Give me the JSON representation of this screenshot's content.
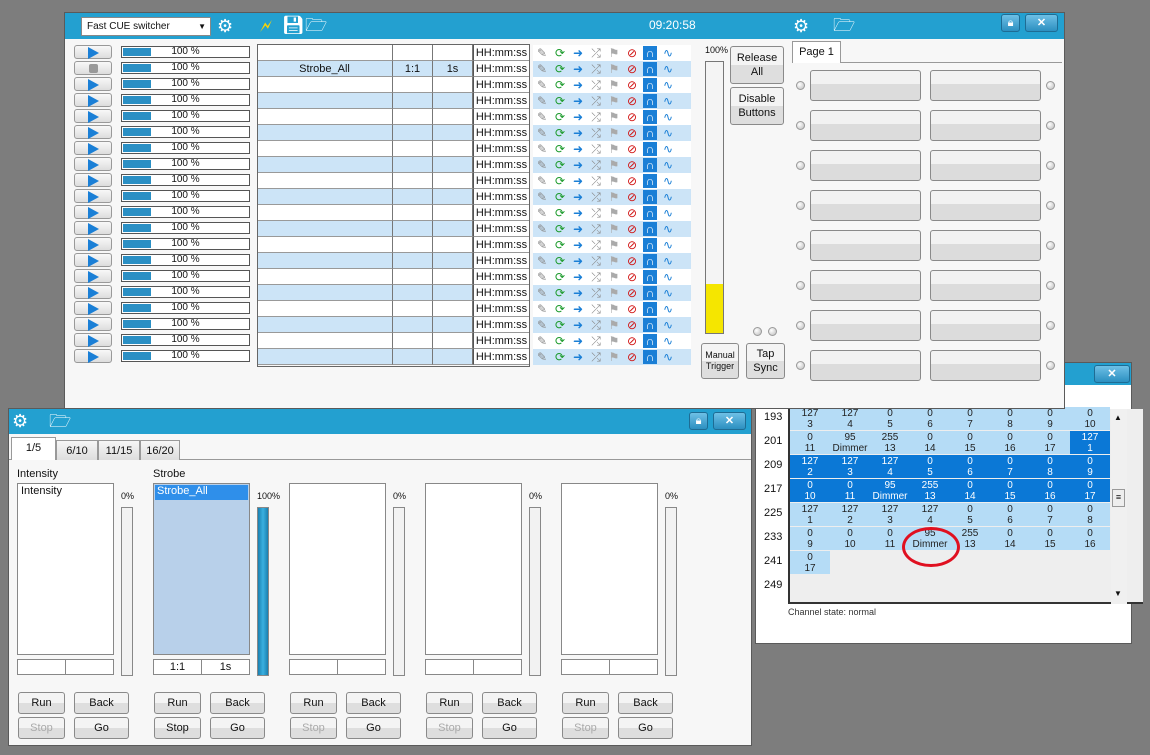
{
  "cue_window": {
    "mode_select": "Fast CUE switcher",
    "clock": "09:20:58",
    "rows": [
      {
        "state": "play",
        "intensity": "100 %",
        "name": "",
        "fade": "",
        "time": "",
        "duration": "HH:mm:ss"
      },
      {
        "state": "stop",
        "intensity": "100 %",
        "name": "Strobe_All",
        "fade": "1:1",
        "time": "1s",
        "duration": "HH:mm:ss"
      },
      {
        "state": "play",
        "intensity": "100 %",
        "name": "",
        "fade": "",
        "time": "",
        "duration": "HH:mm:ss"
      },
      {
        "state": "play",
        "intensity": "100 %",
        "name": "",
        "fade": "",
        "time": "",
        "duration": "HH:mm:ss"
      },
      {
        "state": "play",
        "intensity": "100 %",
        "name": "",
        "fade": "",
        "time": "",
        "duration": "HH:mm:ss"
      },
      {
        "state": "play",
        "intensity": "100 %",
        "name": "",
        "fade": "",
        "time": "",
        "duration": "HH:mm:ss"
      },
      {
        "state": "play",
        "intensity": "100 %",
        "name": "",
        "fade": "",
        "time": "",
        "duration": "HH:mm:ss"
      },
      {
        "state": "play",
        "intensity": "100 %",
        "name": "",
        "fade": "",
        "time": "",
        "duration": "HH:mm:ss"
      },
      {
        "state": "play",
        "intensity": "100 %",
        "name": "",
        "fade": "",
        "time": "",
        "duration": "HH:mm:ss"
      },
      {
        "state": "play",
        "intensity": "100 %",
        "name": "",
        "fade": "",
        "time": "",
        "duration": "HH:mm:ss"
      },
      {
        "state": "play",
        "intensity": "100 %",
        "name": "",
        "fade": "",
        "time": "",
        "duration": "HH:mm:ss"
      },
      {
        "state": "play",
        "intensity": "100 %",
        "name": "",
        "fade": "",
        "time": "",
        "duration": "HH:mm:ss"
      },
      {
        "state": "play",
        "intensity": "100 %",
        "name": "",
        "fade": "",
        "time": "",
        "duration": "HH:mm:ss"
      },
      {
        "state": "play",
        "intensity": "100 %",
        "name": "",
        "fade": "",
        "time": "",
        "duration": "HH:mm:ss"
      },
      {
        "state": "play",
        "intensity": "100 %",
        "name": "",
        "fade": "",
        "time": "",
        "duration": "HH:mm:ss"
      },
      {
        "state": "play",
        "intensity": "100 %",
        "name": "",
        "fade": "",
        "time": "",
        "duration": "HH:mm:ss"
      },
      {
        "state": "play",
        "intensity": "100 %",
        "name": "",
        "fade": "",
        "time": "",
        "duration": "HH:mm:ss"
      },
      {
        "state": "play",
        "intensity": "100 %",
        "name": "",
        "fade": "",
        "time": "",
        "duration": "HH:mm:ss"
      },
      {
        "state": "play",
        "intensity": "100 %",
        "name": "",
        "fade": "",
        "time": "",
        "duration": "HH:mm:ss"
      },
      {
        "state": "play",
        "intensity": "100 %",
        "name": "",
        "fade": "",
        "time": "",
        "duration": "HH:mm:ss"
      }
    ],
    "master_label": "100%",
    "master_level": 0.18,
    "release_all": "Release All",
    "disable_buttons": "Disable Buttons",
    "manual_trigger": "Manual Trigger",
    "tap_sync": "Tap Sync",
    "page_tab": "Page 1",
    "colors": {
      "titlebar": "#23a0d0",
      "row_alt": "#cce4f7",
      "fader": "#f5e600"
    }
  },
  "playback_window": {
    "tabs": [
      "1/5",
      "6/10",
      "11/15",
      "16/20"
    ],
    "panels": [
      {
        "title": "Intensity",
        "item": "Intensity",
        "level": "0%",
        "fill": 0,
        "fade": "",
        "time": "",
        "run": "Run",
        "back": "Back",
        "stop": "Stop",
        "go": "Go",
        "stop_enabled": false
      },
      {
        "title": "Strobe",
        "item": "Strobe_All",
        "level": "100%",
        "fill": 1,
        "fade": "1:1",
        "time": "1s",
        "run": "Run",
        "back": "Back",
        "stop": "Stop",
        "go": "Go",
        "stop_enabled": true
      },
      {
        "title": "",
        "item": "",
        "level": "0%",
        "fill": 0,
        "fade": "",
        "time": "",
        "run": "Run",
        "back": "Back",
        "stop": "Stop",
        "go": "Go",
        "stop_enabled": false
      },
      {
        "title": "",
        "item": "",
        "level": "0%",
        "fill": 0,
        "fade": "",
        "time": "",
        "run": "Run",
        "back": "Back",
        "stop": "Stop",
        "go": "Go",
        "stop_enabled": false
      },
      {
        "title": "",
        "item": "",
        "level": "0%",
        "fill": 0,
        "fade": "",
        "time": "",
        "run": "Run",
        "back": "Back",
        "stop": "Stop",
        "go": "Go",
        "stop_enabled": false
      }
    ]
  },
  "channel_window": {
    "status": "Channel state: normal",
    "rows": [
      {
        "label": "193",
        "cells": [
          [
            "127",
            "3",
            "l"
          ],
          [
            "127",
            "4",
            "l"
          ],
          [
            "0",
            "5",
            "l"
          ],
          [
            "0",
            "6",
            "l"
          ],
          [
            "0",
            "7",
            "l"
          ],
          [
            "0",
            "8",
            "l"
          ],
          [
            "0",
            "9",
            "l"
          ],
          [
            "0",
            "10",
            "l"
          ]
        ]
      },
      {
        "label": "201",
        "cells": [
          [
            "0",
            "11",
            "l"
          ],
          [
            "95",
            "Dimmer",
            "l"
          ],
          [
            "255",
            "13",
            "l"
          ],
          [
            "0",
            "14",
            "l"
          ],
          [
            "0",
            "15",
            "l"
          ],
          [
            "0",
            "16",
            "l"
          ],
          [
            "0",
            "17",
            "l"
          ],
          [
            "127",
            "1",
            "d"
          ]
        ]
      },
      {
        "label": "209",
        "cells": [
          [
            "127",
            "2",
            "d"
          ],
          [
            "127",
            "3",
            "d"
          ],
          [
            "127",
            "4",
            "d"
          ],
          [
            "0",
            "5",
            "d"
          ],
          [
            "0",
            "6",
            "d"
          ],
          [
            "0",
            "7",
            "d"
          ],
          [
            "0",
            "8",
            "d"
          ],
          [
            "0",
            "9",
            "d"
          ]
        ]
      },
      {
        "label": "217",
        "cells": [
          [
            "0",
            "10",
            "d"
          ],
          [
            "0",
            "11",
            "d"
          ],
          [
            "95",
            "Dimmer",
            "d"
          ],
          [
            "255",
            "13",
            "d"
          ],
          [
            "0",
            "14",
            "d"
          ],
          [
            "0",
            "15",
            "d"
          ],
          [
            "0",
            "16",
            "d"
          ],
          [
            "0",
            "17",
            "d"
          ]
        ]
      },
      {
        "label": "225",
        "cells": [
          [
            "127",
            "1",
            "l"
          ],
          [
            "127",
            "2",
            "l"
          ],
          [
            "127",
            "3",
            "l"
          ],
          [
            "127",
            "4",
            "l"
          ],
          [
            "0",
            "5",
            "l"
          ],
          [
            "0",
            "6",
            "l"
          ],
          [
            "0",
            "7",
            "l"
          ],
          [
            "0",
            "8",
            "l"
          ]
        ]
      },
      {
        "label": "233",
        "cells": [
          [
            "0",
            "9",
            "l"
          ],
          [
            "0",
            "10",
            "l"
          ],
          [
            "0",
            "11",
            "l"
          ],
          [
            "95",
            "Dimmer",
            "l"
          ],
          [
            "255",
            "13",
            "l"
          ],
          [
            "0",
            "14",
            "l"
          ],
          [
            "0",
            "15",
            "l"
          ],
          [
            "0",
            "16",
            "l"
          ]
        ]
      },
      {
        "label": "241",
        "cells": [
          [
            "0",
            "17",
            "l"
          ]
        ]
      },
      {
        "label": "249",
        "cells": []
      }
    ]
  }
}
